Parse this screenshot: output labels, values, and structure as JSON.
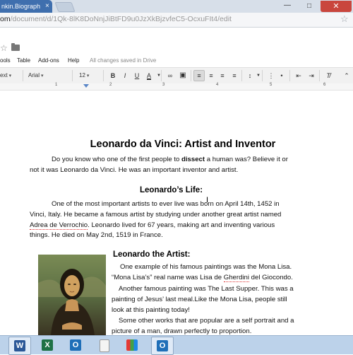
{
  "browser": {
    "tab_title": "nkin.Biograph",
    "tab_close": "×",
    "minimize": "—",
    "maximize": "□",
    "close": "✕",
    "url_host": "om",
    "url_path": "/document/d/1Qk-8lK8DoNnjJiBtFD9u0JzXkBjzvfeC5-OcxuFIt4/edit"
  },
  "docs": {
    "menu": [
      "ools",
      "Table",
      "Add-ons",
      "Help"
    ],
    "save_status": "All changes saved in Drive",
    "toolbar": {
      "style": "ext",
      "font": "Arial",
      "size": "12",
      "bold": "B",
      "italic": "I",
      "underline": "U",
      "text_color": "A"
    },
    "ruler": [
      "1",
      "2",
      "3",
      "4",
      "5",
      "6"
    ]
  },
  "document": {
    "title": "Leonardo da Vinci: Artist and Inventor",
    "intro_before": "Do you know who one of the first people to ",
    "intro_bold": "dissect",
    "intro_after": " a human was? Believe it or",
    "intro_line2": "not it was Leonardo da Vinci. He was an important inventor and artist.",
    "life_heading": "Leonardo’s Life:",
    "life_line1": "One of the most important artists to ever live was born on April 14th, 1452 in",
    "life_line2": "Vinci, Italy. He became a famous artist by studying under another great artist named",
    "life_line3_link": "Adrea de Verrochio",
    "life_line3_rest": ". Leonardo lived for 67 years, making art and inventing various",
    "life_line4": "things. He died on May 2nd, 1519 in France.",
    "artist_heading": "Leonardo the Artist:",
    "artist_line1": "One example of his famous paintings was the Mona Lisa.",
    "artist_line2a": "“Mona Lisa’s” real name was Lisa de ",
    "artist_line2_link": "Gherdini",
    "artist_line2b": " del Giocondo.",
    "artist_line3": "Another famous painting was The Last Supper. This was a",
    "artist_line4": "painting of Jesus’ last meal.Like the Mona Lisa, people still",
    "artist_line5": "look at this painting today!",
    "artist_line6": "Some other works that are popular are a self portrait and a",
    "artist_line7": "picture of a man, drawn perfectly to proportion."
  },
  "taskbar": {
    "items": [
      {
        "icon": "word-icon",
        "glyph": "W",
        "color": "#2b5797"
      },
      {
        "icon": "excel-icon",
        "glyph": "X",
        "color": "#1e7145"
      },
      {
        "icon": "outlook-icon",
        "glyph": "O",
        "color": "#1f6fb8"
      },
      {
        "icon": "blank-file-icon",
        "glyph": "",
        "color": "#f4f4f4"
      },
      {
        "icon": "app-grid-icon",
        "glyph": "",
        "color": "#ffffff"
      },
      {
        "icon": "outlook-icon",
        "glyph": "O",
        "color": "#1f6fb8"
      }
    ]
  }
}
